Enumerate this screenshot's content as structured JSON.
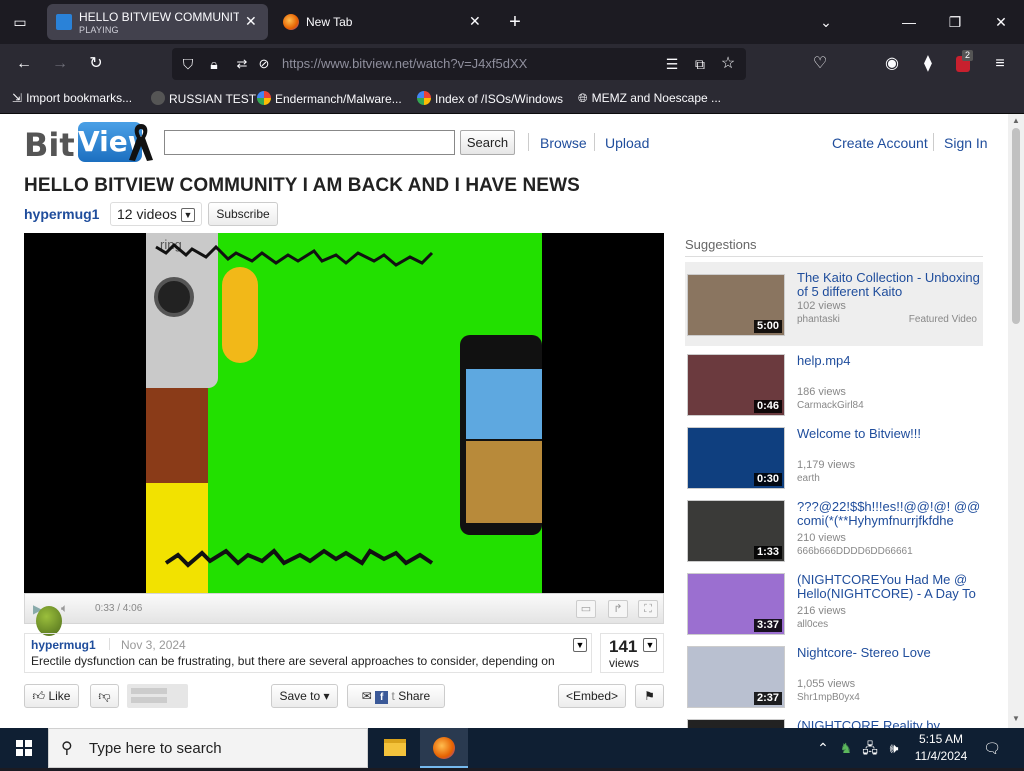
{
  "browser": {
    "tabs": [
      {
        "title": "HELLO BITVIEW COMMUNITY I",
        "subtitle": "PLAYING",
        "active": true
      },
      {
        "title": "New Tab",
        "active": false
      }
    ],
    "new_tab_glyph": "+",
    "url_scheme_host": "https://www.bitview.net",
    "url_path": "/watch?v=J4xf5dXX",
    "extension_badge": "2",
    "bookmarks": [
      {
        "label": "Import bookmarks...",
        "icon": "import-icon"
      },
      {
        "label": "RUSSIAN TEST",
        "icon": "avatar-icon"
      },
      {
        "label": "Endermanch/Malware...",
        "icon": "google-icon"
      },
      {
        "label": "Index of /ISOs/Windows",
        "icon": "google-icon"
      },
      {
        "label": "MEMZ and Noescape ...",
        "icon": "globe-icon"
      }
    ]
  },
  "site": {
    "logo_bit": "Bit",
    "logo_view": "View",
    "search_placeholder": "",
    "search_button": "Search",
    "nav": {
      "browse": "Browse",
      "upload": "Upload",
      "create_account": "Create Account",
      "sign_in": "Sign In"
    }
  },
  "video": {
    "title": "HELLO BITVIEW COMMUNITY I AM BACK AND I HAVE NEWS",
    "uploader": "hypermug1",
    "video_count": "12 videos",
    "subscribe": "Subscribe",
    "time": "0:33 / 4:06",
    "date": "Nov 3, 2024",
    "description": "Erectile dysfunction can be frustrating, but there are several approaches to consider, depending on",
    "views_count": "141",
    "views_label": "views",
    "actions": {
      "like": "Like",
      "save_to": "Save to",
      "share": "Share",
      "embed": "<Embed>"
    }
  },
  "suggestions": {
    "heading": "Suggestions",
    "items": [
      {
        "title": "The Kaito Collection - Unboxing of 5 different Kaito",
        "views": "102 views",
        "user": "phantaski",
        "duration": "5:00",
        "badge": "Featured Video",
        "thumb_color": "#8a7560"
      },
      {
        "title": "help.mp4",
        "views": "186 views",
        "user": "CarmackGirl84",
        "duration": "0:46",
        "badge": "",
        "thumb_color": "#6b3a3e"
      },
      {
        "title": "Welcome to Bitview!!!",
        "views": "1,179 views",
        "user": "earth",
        "duration": "0:30",
        "badge": "",
        "thumb_color": "#0f3f7f"
      },
      {
        "title": "???@22!$$h!!!es!!@@!@! @@comi(*(**Hyhymfnurrjfkfdhe",
        "views": "210 views",
        "user": "666b666DDDD6DD66661",
        "duration": "1:33",
        "badge": "",
        "thumb_color": "#3a3a38"
      },
      {
        "title": "(NIGHTCOREYou Had Me @ Hello(NIGHTCORE) - A Day To",
        "views": "216 views",
        "user": "all0ces",
        "duration": "3:37",
        "badge": "",
        "thumb_color": "#9b6fd0"
      },
      {
        "title": "Nightcore- Stereo Love",
        "views": "1,055 views",
        "user": "Shr1mpB0yx4",
        "duration": "2:37",
        "badge": "",
        "thumb_color": "#b9c0d0"
      },
      {
        "title": "(NIGHTCORE Reality by",
        "views": "",
        "user": "",
        "duration": "",
        "badge": "",
        "thumb_color": "#222"
      }
    ]
  },
  "taskbar": {
    "search_placeholder": "Type here to search",
    "time": "5:15 AM",
    "date": "11/4/2024"
  },
  "colors": {
    "link": "#1f4d9c",
    "green_screen": "#22e000",
    "taskbar": "#0f1f33"
  }
}
